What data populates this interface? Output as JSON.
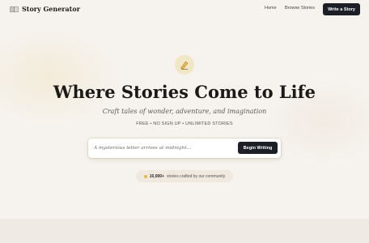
{
  "brand": {
    "name": "Story Generator",
    "icon": "open-book-icon"
  },
  "nav": {
    "home_label": "Home",
    "browse_label": "Browse Stories",
    "cta_label": "Write a Story"
  },
  "hero": {
    "badge_icon": "quill-icon",
    "headline": "Where Stories Come to Life",
    "subhead": "Craft tales of wonder, adventure, and imagination",
    "tagline": "FREE • NO SIGN UP • UNLIMITED STORIES"
  },
  "prompt": {
    "placeholder": "A mysterious letter arrives at midnight...",
    "value": "",
    "button_label": "Begin Writing"
  },
  "community": {
    "count": "10,000+",
    "text": "stories crafted by our community",
    "dot_color": "#e8b84a"
  },
  "colors": {
    "accent_dark": "#1c1f26",
    "background": "#f6f3ee",
    "badge_gold": "#f1e6c6"
  }
}
